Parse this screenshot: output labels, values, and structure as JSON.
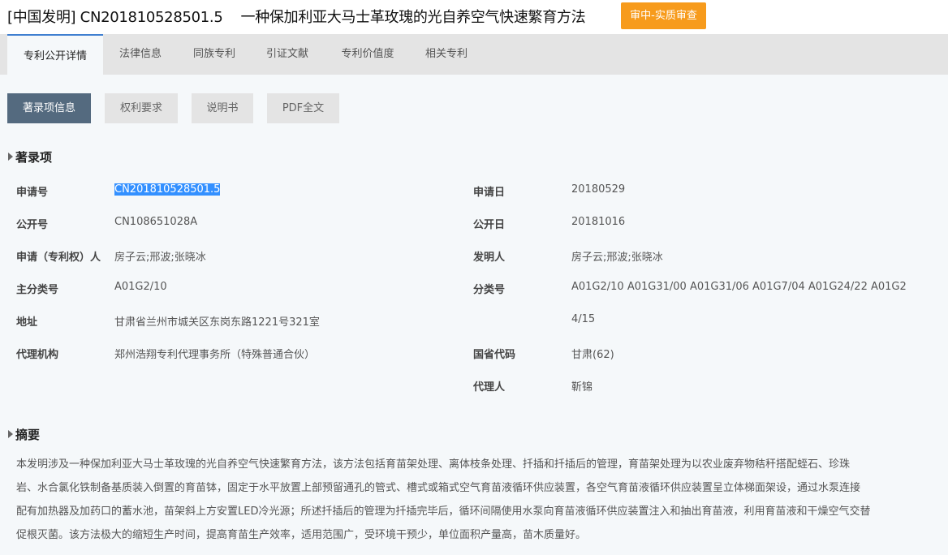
{
  "header": {
    "doc_type": "[中国发明]",
    "app_no": "CN201810528501.5",
    "title": "一种保加利亚大马士革玫瑰的光自养空气快速繁育方法",
    "status": "审中-实质审查"
  },
  "tabs": [
    "专利公开详情",
    "法律信息",
    "同族专利",
    "引证文献",
    "专利价值度",
    "相关专利"
  ],
  "subtabs": [
    "著录项信息",
    "权利要求",
    "说明书",
    "PDF全文"
  ],
  "biblio": {
    "section_title": "著录项",
    "left": [
      {
        "label": "申请号",
        "value": "CN201810528501.5"
      },
      {
        "label": "公开号",
        "value": "CN108651028A"
      },
      {
        "label": "申请（专利权）人",
        "value": "房子云;邢波;张晓冰"
      },
      {
        "label": "主分类号",
        "value": "A01G2/10"
      },
      {
        "label": "地址",
        "value": "甘肃省兰州市城关区东岗东路1221号321室"
      },
      {
        "label": "代理机构",
        "value": "郑州浩翔专利代理事务所（特殊普通合伙）"
      }
    ],
    "right": [
      {
        "label": "申请日",
        "value": "20180529"
      },
      {
        "label": "公开日",
        "value": "20181016"
      },
      {
        "label": "发明人",
        "value": "房子云;邢波;张晓冰"
      },
      {
        "label": "分类号",
        "value": "A01G2/10 A01G31/00 A01G31/06 A01G7/04 A01G24/22 A01G2"
      },
      {
        "label": "",
        "value": "4/15"
      },
      {
        "label": "国省代码",
        "value": "甘肃(62)"
      },
      {
        "label": "代理人",
        "value": "靳锦"
      }
    ]
  },
  "abstract": {
    "section_title": "摘要",
    "lines": [
      "本发明涉及一种保加利亚大马士革玫瑰的光自养空气快速繁育方法，该方法包括育苗架处理、离体枝条处理、扦插和扦插后的管理，育苗架处理为以农业废弃物秸秆搭配蛭石、珍珠",
      "岩、水合氯化铁制备基质装入倒置的育苗钵，固定于水平放置上部预留通孔的管式、槽式或箱式空气育苗液循环供应装置，各空气育苗液循环供应装置呈立体梯面架设，通过水泵连接",
      "配有加热器及加药口的蓄水池，苗架斜上方安置LED冷光源；所述扦插后的管理为扦插完毕后，循环间隔使用水泵向育苗液循环供应装置注入和抽出育苗液，利用育苗液和干燥空气交替",
      "促根灭菌。该方法极大的缩短生产时间，提高育苗生产效率，适用范围广，受环境干预少，单位面积产量高，苗木质量好。"
    ]
  }
}
